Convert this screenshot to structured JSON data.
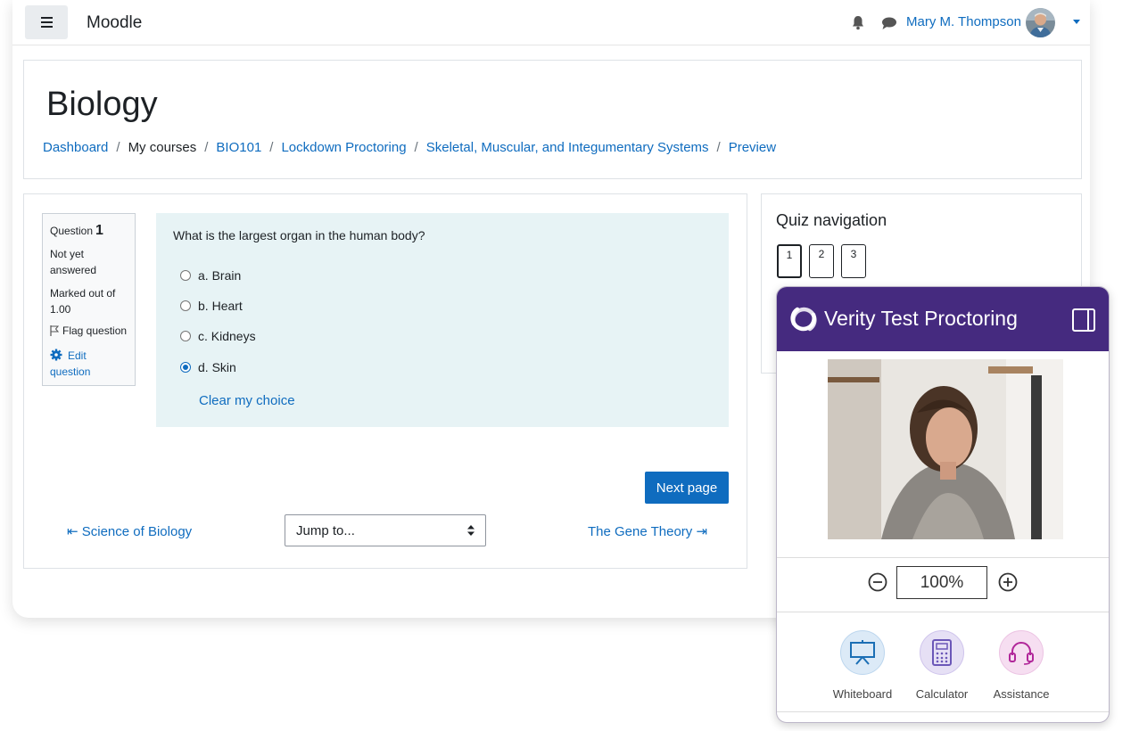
{
  "navbar": {
    "brand": "Moodle",
    "user_name": "Mary M. Thompson",
    "icons": [
      "menu-icon",
      "bell-icon",
      "chat-icon",
      "caret-down-icon"
    ]
  },
  "header": {
    "title": "Biology",
    "breadcrumb": [
      {
        "label": "Dashboard",
        "link": true
      },
      {
        "label": "My courses",
        "link": false
      },
      {
        "label": "BIO101",
        "link": true
      },
      {
        "label": "Lockdown Proctoring",
        "link": true
      },
      {
        "label": "Skeletal, Muscular, and Integumentary Systems",
        "link": true
      },
      {
        "label": "Preview",
        "link": true
      }
    ],
    "separator": "/"
  },
  "question_info": {
    "question_label": "Question",
    "question_number": "1",
    "state": "Not yet answered",
    "marked_out_of": "Marked out of 1.00",
    "flag_label": "Flag question",
    "edit_label": "Edit question"
  },
  "question": {
    "text": "What is the largest organ in the human body?",
    "options": [
      {
        "letter": "a.",
        "label": "Brain",
        "selected": false
      },
      {
        "letter": "b.",
        "label": "Heart",
        "selected": false
      },
      {
        "letter": "c.",
        "label": "Kidneys",
        "selected": false
      },
      {
        "letter": "d.",
        "label": "Skin",
        "selected": true
      }
    ],
    "clear_choice": "Clear my choice"
  },
  "actions": {
    "next_page": "Next page",
    "prev_activity": "Science of Biology",
    "prev_arrow": "⇤",
    "jump_placeholder": "Jump to...",
    "next_activity": "The Gene Theory",
    "next_arrow": "⇥"
  },
  "quiz_navigation": {
    "title": "Quiz navigation",
    "questions": [
      "1",
      "2",
      "3"
    ],
    "current": "1"
  },
  "proctoring": {
    "title": "Verity Test Proctoring",
    "zoom": "100%",
    "tools": [
      {
        "label": "Whiteboard",
        "icon": "whiteboard-icon",
        "color": "#1b6fb5",
        "bg": "#dceaf7"
      },
      {
        "label": "Calculator",
        "icon": "calculator-icon",
        "color": "#6b57b8",
        "bg": "#e6e0f5"
      },
      {
        "label": "Assistance",
        "icon": "headset-icon",
        "color": "#b1279a",
        "bg": "#f6def1"
      }
    ],
    "header_color": "#452a7f"
  },
  "colors": {
    "link": "#0f6cbf",
    "question_bg": "#e7f3f5",
    "primary_button": "#0f6cbf"
  }
}
